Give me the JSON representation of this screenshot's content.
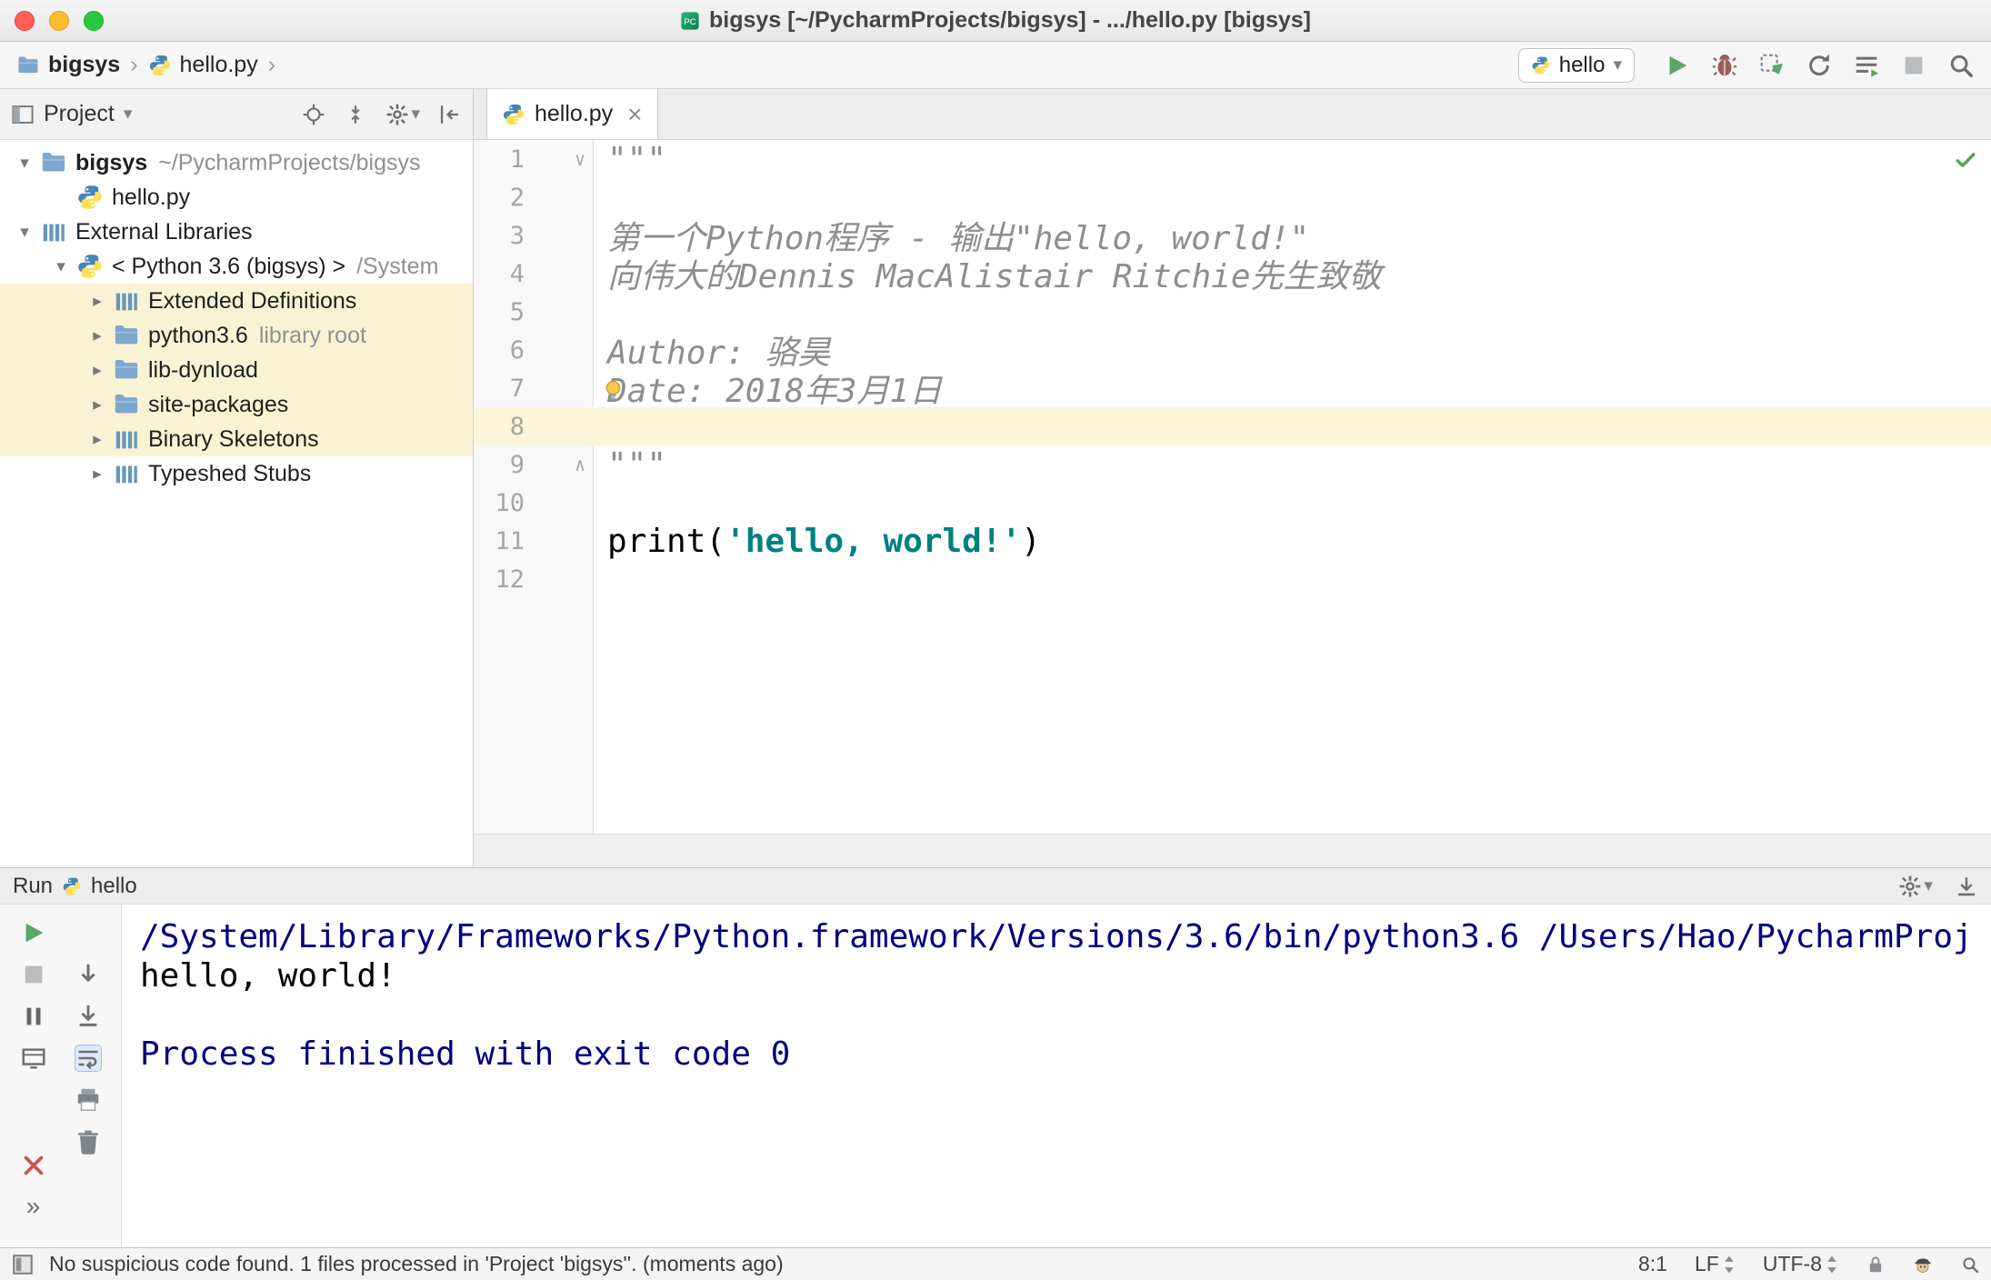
{
  "window": {
    "title": "bigsys [~/PycharmProjects/bigsys] - .../hello.py [bigsys]"
  },
  "navbar": {
    "breadcrumbs": [
      {
        "label": "bigsys",
        "icon": "folder-icon"
      },
      {
        "label": "hello.py",
        "icon": "python-icon"
      }
    ],
    "run_config": {
      "label": "hello",
      "icon": "python-icon"
    },
    "actions": [
      "run",
      "debug",
      "run-with-coverage",
      "profiler",
      "edit-configurations",
      "stop",
      "search-everywhere"
    ]
  },
  "project_panel": {
    "title": "Project",
    "tree": [
      {
        "label": "bigsys",
        "annotation": "~/PycharmProjects/bigsys",
        "icon": "folder-icon",
        "state": "expanded",
        "indent": 0,
        "bold": true,
        "highlight": false
      },
      {
        "label": "hello.py",
        "icon": "python-icon",
        "state": "none",
        "indent": 1,
        "bold": false,
        "highlight": false
      },
      {
        "label": "External Libraries",
        "icon": "library-icon",
        "state": "expanded",
        "indent": 0,
        "bold": false,
        "highlight": false
      },
      {
        "label": "< Python 3.6 (bigsys) >",
        "annotation": "/System",
        "icon": "python-icon",
        "state": "expanded",
        "indent": 1,
        "bold": false,
        "highlight": false
      },
      {
        "label": "Extended Definitions",
        "icon": "library-icon",
        "state": "collapsed",
        "indent": 2,
        "bold": false,
        "highlight": true
      },
      {
        "label": "python3.6",
        "annotation": "library root",
        "icon": "folder-icon",
        "state": "collapsed",
        "indent": 2,
        "bold": false,
        "highlight": true
      },
      {
        "label": "lib-dynload",
        "icon": "folder-icon",
        "state": "collapsed",
        "indent": 2,
        "bold": false,
        "highlight": true
      },
      {
        "label": "site-packages",
        "icon": "folder-icon",
        "state": "collapsed",
        "indent": 2,
        "bold": false,
        "highlight": true
      },
      {
        "label": "Binary Skeletons",
        "icon": "library-icon",
        "state": "collapsed",
        "indent": 2,
        "bold": false,
        "highlight": true
      },
      {
        "label": "Typeshed Stubs",
        "icon": "library-icon",
        "state": "collapsed",
        "indent": 2,
        "bold": false,
        "highlight": false
      }
    ]
  },
  "editor": {
    "tab": "hello.py",
    "lines": [
      {
        "num": 1,
        "fold": "open-top",
        "segments": [
          {
            "t": "\"\"\"",
            "s": "doc"
          }
        ]
      },
      {
        "num": 2,
        "segments": []
      },
      {
        "num": 3,
        "segments": [
          {
            "t": "第一个Python程序 - 输出\"hello, world!\"",
            "s": "doc"
          }
        ]
      },
      {
        "num": 4,
        "segments": [
          {
            "t": "向伟大的Dennis MacAlistair Ritchie先生致敬",
            "s": "doc"
          }
        ]
      },
      {
        "num": 5,
        "segments": []
      },
      {
        "num": 6,
        "segments": [
          {
            "t": "Author: 骆昊",
            "s": "doc"
          }
        ]
      },
      {
        "num": 7,
        "bulb": true,
        "segments": [
          {
            "t": "Date: 2018年3月1日",
            "s": "doc"
          }
        ]
      },
      {
        "num": 8,
        "current": true,
        "segments": []
      },
      {
        "num": 9,
        "fold": "open-bottom",
        "segments": [
          {
            "t": "\"\"\"",
            "s": "doc"
          }
        ]
      },
      {
        "num": 10,
        "segments": []
      },
      {
        "num": 11,
        "segments": [
          {
            "t": "print",
            "s": "plain"
          },
          {
            "t": "(",
            "s": "plain"
          },
          {
            "t": "'hello, world!'",
            "s": "str"
          },
          {
            "t": ")",
            "s": "plain"
          }
        ]
      },
      {
        "num": 12,
        "segments": []
      }
    ]
  },
  "run_panel": {
    "title": "Run",
    "config": {
      "label": "hello",
      "icon": "python-icon"
    },
    "console": [
      {
        "text": "/System/Library/Frameworks/Python.framework/Versions/3.6/bin/python3.6 /Users/Hao/PycharmProj",
        "style": "system"
      },
      {
        "text": "hello, world!",
        "style": "stdout"
      },
      {
        "text": "",
        "style": "stdout"
      },
      {
        "text": "Process finished with exit code 0",
        "style": "system"
      }
    ]
  },
  "status_bar": {
    "message": "No suspicious code found. 1 files processed in 'Project 'bigsys''. (moments ago)",
    "caret_position": "8:1",
    "line_separator": "LF",
    "encoding": "UTF-8"
  },
  "colors": {
    "string_token": "#008080",
    "docstring_token": "#8e8e8e",
    "console_system_text": "#000080",
    "run_green": "#59a869",
    "library_highlight": "#faf3d3",
    "current_line": "#fcf5d8"
  }
}
